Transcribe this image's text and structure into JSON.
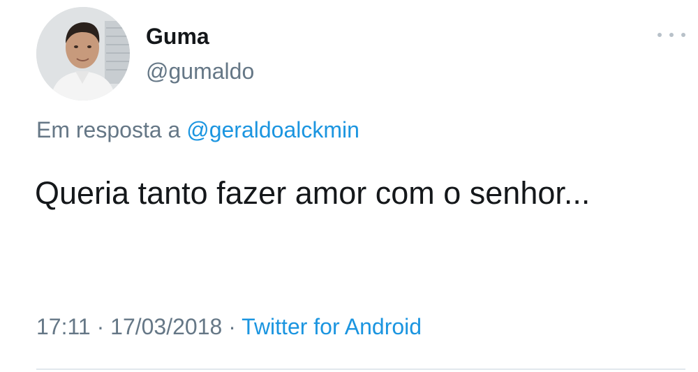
{
  "author": {
    "name": "Guma",
    "handle": "@gumaldo"
  },
  "reply": {
    "prefix": "Em resposta a",
    "mention": "@geraldoalckmin"
  },
  "tweet": {
    "text": "Queria tanto fazer amor com o senhor..."
  },
  "meta": {
    "time": "17:11",
    "separator": "·",
    "date": "17/03/2018",
    "source": "Twitter for Android"
  },
  "icons": {
    "more": "more-horizontal-icon"
  },
  "colors": {
    "text_primary": "#14171a",
    "text_secondary": "#657786",
    "link": "#1b95e0",
    "divider": "#e1e8ed"
  }
}
